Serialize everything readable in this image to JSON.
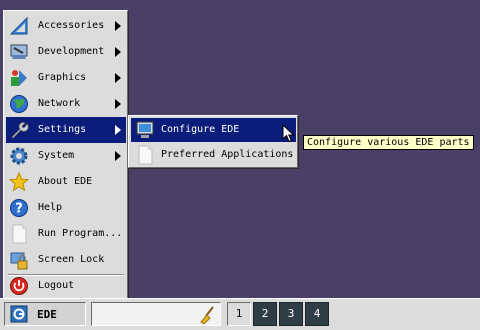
{
  "menu": {
    "items": [
      {
        "label": "Accessories",
        "icon": "accessories-icon",
        "submenu": true
      },
      {
        "label": "Development",
        "icon": "development-icon",
        "submenu": true
      },
      {
        "label": "Graphics",
        "icon": "graphics-icon",
        "submenu": true
      },
      {
        "label": "Network",
        "icon": "network-icon",
        "submenu": true
      },
      {
        "label": "Settings",
        "icon": "settings-icon",
        "submenu": true,
        "active": true
      },
      {
        "label": "System",
        "icon": "system-icon",
        "submenu": true
      },
      {
        "label": "About EDE",
        "icon": "star-icon",
        "submenu": false
      },
      {
        "label": "Help",
        "icon": "help-icon",
        "submenu": false
      },
      {
        "label": "Run Program...",
        "icon": "document-icon",
        "submenu": false
      },
      {
        "label": "Screen Lock",
        "icon": "lock-icon",
        "submenu": false
      },
      {
        "label": "Logout",
        "icon": "power-icon",
        "submenu": false
      }
    ]
  },
  "submenu": {
    "items": [
      {
        "label": "Configure EDE",
        "icon": "monitor-icon",
        "active": true
      },
      {
        "label": "Preferred Applications",
        "icon": "document-icon"
      }
    ]
  },
  "tooltip": {
    "text": "Configure various EDE parts"
  },
  "taskbar": {
    "start_label": "EDE",
    "workspaces": [
      "1",
      "2",
      "3",
      "4"
    ],
    "current_workspace": "1"
  },
  "colors": {
    "desktop": "#4a3f66",
    "highlight": "#0b1d7a",
    "menu_bg": "#dcdcdc",
    "tooltip_bg": "#ffffc8"
  }
}
